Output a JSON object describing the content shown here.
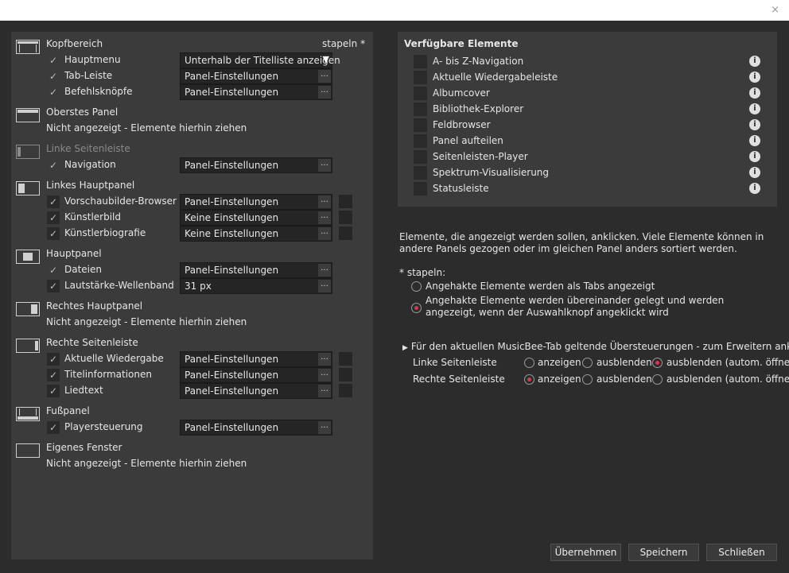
{
  "window": {
    "close_glyph": "×"
  },
  "layout": {
    "stapeln_header": "stapeln *",
    "sections": {
      "kopf": {
        "title": "Kopfbereich",
        "rows": [
          {
            "label": "Hauptmenu",
            "value": "Unterhalb der Titelliste anzeigen",
            "checked": true
          },
          {
            "label": "Tab-Leiste",
            "value": "Panel-Einstellungen",
            "checked": true
          },
          {
            "label": "Befehlsknöpfe",
            "value": "Panel-Einstellungen",
            "checked": true
          }
        ]
      },
      "oberstes": {
        "title": "Oberstes Panel",
        "empty": "Nicht angezeigt - Elemente hierhin ziehen"
      },
      "linke_seite": {
        "title": "Linke Seitenleiste",
        "rows": [
          {
            "label": "Navigation",
            "value": "Panel-Einstellungen",
            "checked": true
          }
        ]
      },
      "linkes_haupt": {
        "title": "Linkes Hauptpanel",
        "rows": [
          {
            "label": "Vorschaubilder-Browser",
            "value": "Panel-Einstellungen",
            "checked": true
          },
          {
            "label": "Künstlerbild",
            "value": "Keine Einstellungen",
            "checked": true
          },
          {
            "label": "Künstlerbiografie",
            "value": "Keine Einstellungen",
            "checked": true
          }
        ]
      },
      "haupt": {
        "title": "Hauptpanel",
        "rows": [
          {
            "label": "Dateien",
            "value": "Panel-Einstellungen",
            "checked": true
          },
          {
            "label": "Lautstärke-Wellenband",
            "value": "31 px",
            "checked": true
          }
        ]
      },
      "rechtes_haupt": {
        "title": "Rechtes Hauptpanel",
        "empty": "Nicht angezeigt - Elemente hierhin ziehen"
      },
      "rechte_seite": {
        "title": "Rechte Seitenleiste",
        "rows": [
          {
            "label": "Aktuelle Wiedergabe",
            "value": "Panel-Einstellungen",
            "checked": true
          },
          {
            "label": "Titelinformationen",
            "value": "Panel-Einstellungen",
            "checked": true
          },
          {
            "label": "Liedtext",
            "value": "Panel-Einstellungen",
            "checked": true
          }
        ]
      },
      "fuss": {
        "title": "Fußpanel",
        "rows": [
          {
            "label": "Playersteuerung",
            "value": "Panel-Einstellungen",
            "checked": true
          }
        ]
      },
      "eigenes": {
        "title": "Eigenes Fenster",
        "empty": "Nicht angezeigt - Elemente hierhin ziehen"
      }
    },
    "ellipsis": "...",
    "dropdown_arrow": "▼",
    "checkmark": "✓"
  },
  "available": {
    "title": "Verfügbare Elemente",
    "info_glyph": "i",
    "items": [
      "A- bis Z-Navigation",
      "Aktuelle Wiedergabeleiste",
      "Albumcover",
      "Bibliothek-Explorer",
      "Feldbrowser",
      "Panel aufteilen",
      "Seitenleisten-Player",
      "Spektrum-Visualisierung",
      "Statusleiste"
    ]
  },
  "description": "Elemente, die angezeigt werden sollen, anklicken. Viele Elemente können in andere Panels gezogen oder im gleichen Panel anders sortiert werden.",
  "stapeln": {
    "label": "* stapeln:",
    "option_tabs": "Angehakte Elemente werden als Tabs angezeigt",
    "option_stacked": "Angehakte Elemente werden übereinander gelegt und werden angezeigt, wenn der Auswahlknopf angeklickt wird",
    "selected": "stacked"
  },
  "overrides": {
    "arrow": "▶",
    "header": "Für den aktuellen MusicBee-Tab geltende Übersteuerungen - zum Erweitern anklicken",
    "options": [
      "anzeigen",
      "ausblenden",
      "ausblenden (autom. öffnen)"
    ],
    "rows": [
      {
        "label": "Linke Seitenleiste",
        "selected": 2
      },
      {
        "label": "Rechte Seitenleiste",
        "selected": 0
      }
    ]
  },
  "buttons": {
    "apply": "Übernehmen",
    "save": "Speichern",
    "close": "Schließen"
  },
  "colors": {
    "background": "#2c2c2c",
    "panel": "#3b3b3b",
    "field": "#252525",
    "radio_accent": "#e0344a"
  }
}
